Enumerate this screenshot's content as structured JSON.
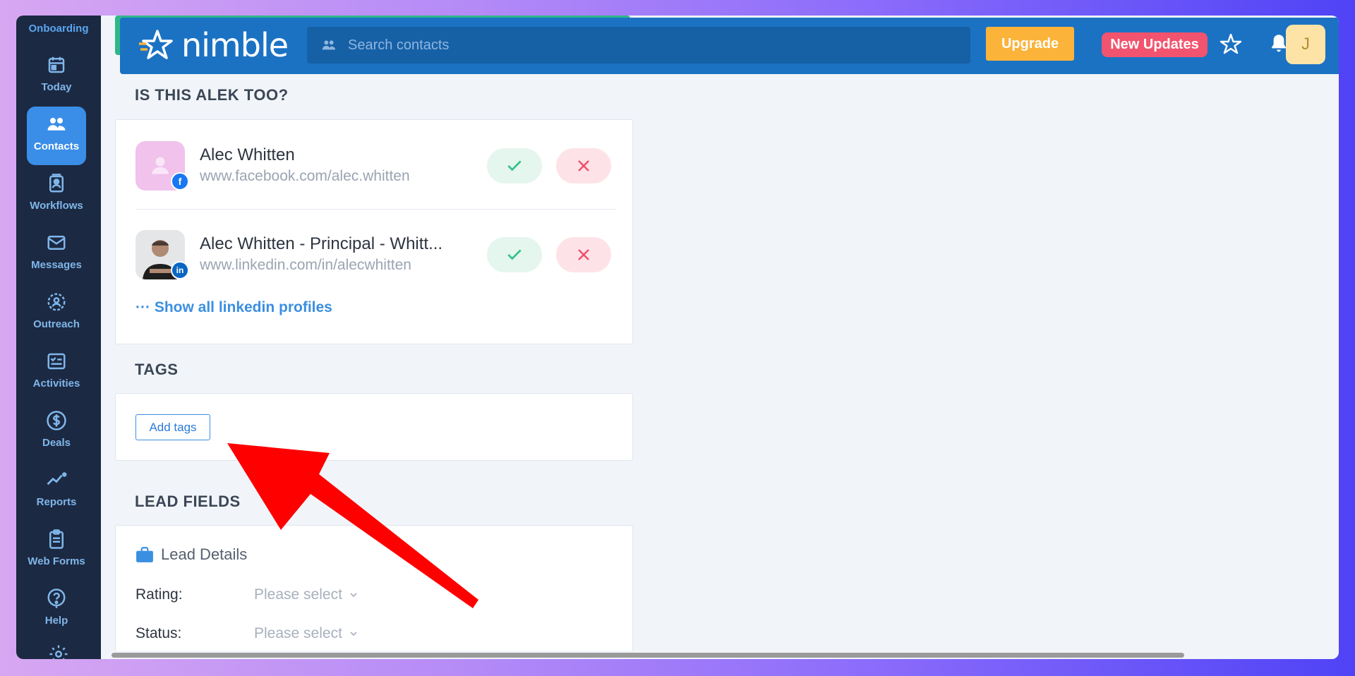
{
  "sidebar": {
    "onboarding": "Onboarding",
    "items": [
      {
        "label": "Today",
        "icon": "calendar-icon"
      },
      {
        "label": "Contacts",
        "icon": "people-icon",
        "active": true
      },
      {
        "label": "Workflows",
        "icon": "workflows-icon"
      },
      {
        "label": "Messages",
        "icon": "envelope-icon"
      },
      {
        "label": "Outreach",
        "icon": "outreach-icon"
      },
      {
        "label": "Activities",
        "icon": "checklist-icon"
      },
      {
        "label": "Deals",
        "icon": "dollar-icon"
      },
      {
        "label": "Reports",
        "icon": "chart-line-icon"
      },
      {
        "label": "Web Forms",
        "icon": "clipboard-icon"
      },
      {
        "label": "Help",
        "icon": "question-icon"
      }
    ]
  },
  "topbar": {
    "logo_text": "nimble",
    "search_placeholder": "Search contacts",
    "upgrade": "Upgrade",
    "new_updates": "New Updates",
    "avatar_initial": "J",
    "colors": {
      "bar": "#1b72c3",
      "upgrade": "#fbb339",
      "updates": "#f2536e"
    }
  },
  "matches": {
    "title": "IS THIS ALEK TOO?",
    "profiles": [
      {
        "name": "Alec Whitten",
        "url": "www.facebook.com/alec.whitten",
        "network": "facebook"
      },
      {
        "name": "Alec Whitten - Principal - Whitt...",
        "url": "www.linkedin.com/in/alecwhitten",
        "network": "linkedin"
      }
    ],
    "show_all": "··· Show all linkedin profiles"
  },
  "tags": {
    "title": "TAGS",
    "add_button": "Add tags"
  },
  "lead_fields": {
    "title": "LEAD FIELDS",
    "details_heading": "Lead Details",
    "fields": [
      {
        "label": "Rating:",
        "value": "Please select"
      },
      {
        "label": "Status:",
        "value": "Please select"
      }
    ]
  }
}
